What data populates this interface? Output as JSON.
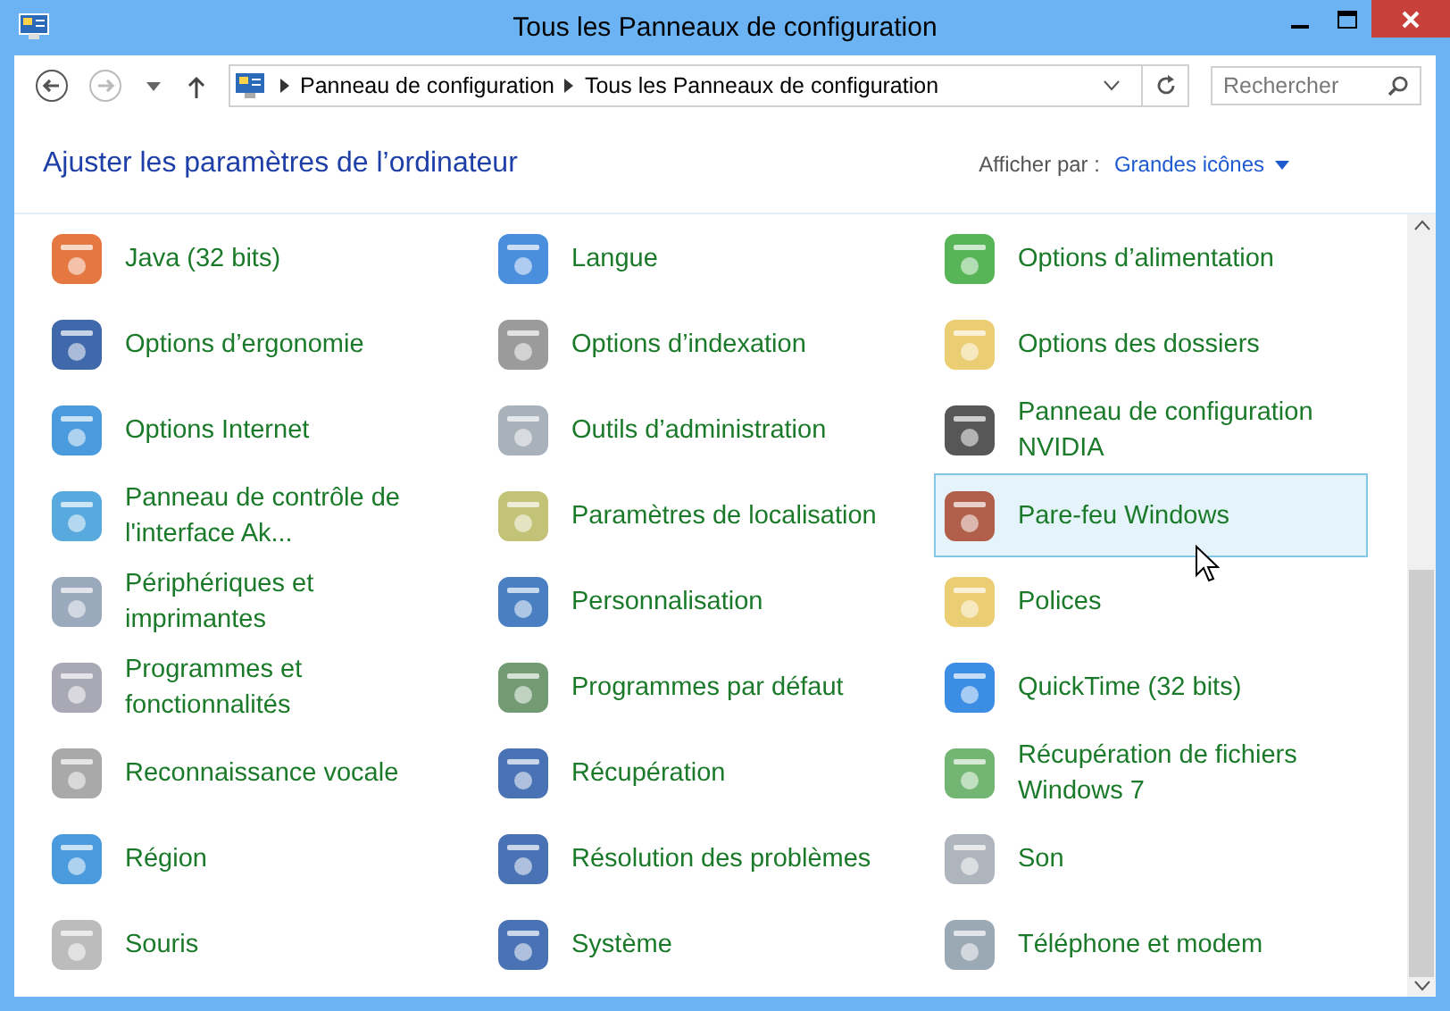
{
  "window": {
    "title": "Tous les Panneaux de configuration"
  },
  "address_bar": {
    "breadcrumbs": [
      "Panneau de configuration",
      "Tous les Panneaux de configuration"
    ]
  },
  "search": {
    "placeholder": "Rechercher"
  },
  "header": {
    "title": "Ajuster les paramètres de l’ordinateur",
    "view_label": "Afficher par :",
    "view_value": "Grandes icônes"
  },
  "items": [
    {
      "label": "Java (32 bits)",
      "selected": false
    },
    {
      "label": "Langue",
      "selected": false
    },
    {
      "label": "Options d’alimentation",
      "selected": false
    },
    {
      "label": "Options d’ergonomie",
      "selected": false
    },
    {
      "label": "Options d’indexation",
      "selected": false
    },
    {
      "label": "Options des dossiers",
      "selected": false
    },
    {
      "label": "Options Internet",
      "selected": false
    },
    {
      "label": "Outils d’administration",
      "selected": false
    },
    {
      "label": "Panneau de configuration NVIDIA",
      "selected": false
    },
    {
      "label": "Panneau de contrôle de l'interface Ak...",
      "selected": false
    },
    {
      "label": "Paramètres de localisation",
      "selected": false
    },
    {
      "label": "Pare-feu Windows",
      "selected": true
    },
    {
      "label": "Périphériques et imprimantes",
      "selected": false
    },
    {
      "label": "Personnalisation",
      "selected": false
    },
    {
      "label": "Polices",
      "selected": false
    },
    {
      "label": "Programmes et fonctionnalités",
      "selected": false
    },
    {
      "label": "Programmes par défaut",
      "selected": false
    },
    {
      "label": "QuickTime (32 bits)",
      "selected": false
    },
    {
      "label": "Reconnaissance vocale",
      "selected": false
    },
    {
      "label": "Récupération",
      "selected": false
    },
    {
      "label": "Récupération de fichiers Windows 7",
      "selected": false
    },
    {
      "label": "Région",
      "selected": false
    },
    {
      "label": "Résolution des problèmes",
      "selected": false
    },
    {
      "label": "Son",
      "selected": false
    },
    {
      "label": "Souris",
      "selected": false
    },
    {
      "label": "Système",
      "selected": false
    },
    {
      "label": "Téléphone et modem",
      "selected": false
    }
  ]
}
